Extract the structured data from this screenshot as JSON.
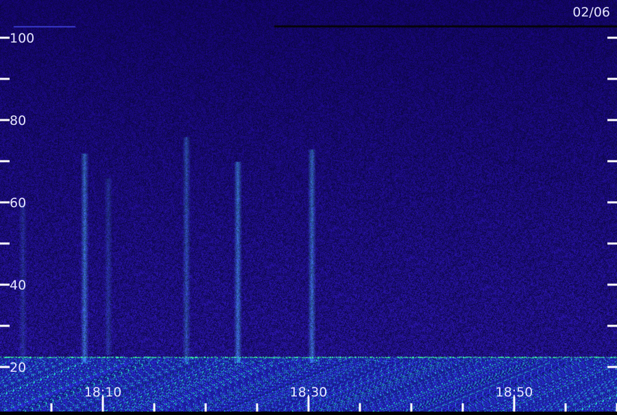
{
  "chart_data": {
    "type": "heatmap",
    "date": "02/06",
    "y_ticks": [
      {
        "value": 20,
        "label": "20"
      },
      {
        "value": 30,
        "label": ""
      },
      {
        "value": 40,
        "label": "40"
      },
      {
        "value": 50,
        "label": ""
      },
      {
        "value": 60,
        "label": "60"
      },
      {
        "value": 70,
        "label": ""
      },
      {
        "value": 80,
        "label": "80"
      },
      {
        "value": 90,
        "label": ""
      },
      {
        "value": 100,
        "label": "100"
      }
    ],
    "x_ticks": [
      {
        "minute": 5,
        "label": ""
      },
      {
        "minute": 10,
        "label": "18:10"
      },
      {
        "minute": 15,
        "label": ""
      },
      {
        "minute": 20,
        "label": ""
      },
      {
        "minute": 25,
        "label": ""
      },
      {
        "minute": 30,
        "label": "18:30"
      },
      {
        "minute": 35,
        "label": ""
      },
      {
        "minute": 40,
        "label": ""
      },
      {
        "minute": 45,
        "label": ""
      },
      {
        "minute": 50,
        "label": "18:50"
      },
      {
        "minute": 55,
        "label": ""
      },
      {
        "minute": 60,
        "label": ""
      }
    ],
    "ylim": [
      20,
      100
    ],
    "xlim_minutes": [
      0,
      60
    ],
    "vertical_streaks": [
      {
        "minute": 8.2,
        "top": 72,
        "bottom": 21,
        "intensity": 0.85
      },
      {
        "minute": 10.5,
        "top": 66,
        "bottom": 23,
        "intensity": 0.35
      },
      {
        "minute": 18.1,
        "top": 76,
        "bottom": 21,
        "intensity": 0.6
      },
      {
        "minute": 23.1,
        "top": 70,
        "bottom": 21,
        "intensity": 0.9
      },
      {
        "minute": 30.3,
        "top": 73,
        "bottom": 21,
        "intensity": 0.85
      },
      {
        "minute": 2.2,
        "top": 60,
        "bottom": 21,
        "intensity": 0.3
      }
    ],
    "bottom_interference_band": [
      20,
      22.5
    ]
  },
  "colors": {
    "background_low": "#0a0640",
    "background_high": "#1a1aa0",
    "streak": "#58b8ff",
    "interference": "#40ffd0",
    "axis": "#ffffff"
  }
}
